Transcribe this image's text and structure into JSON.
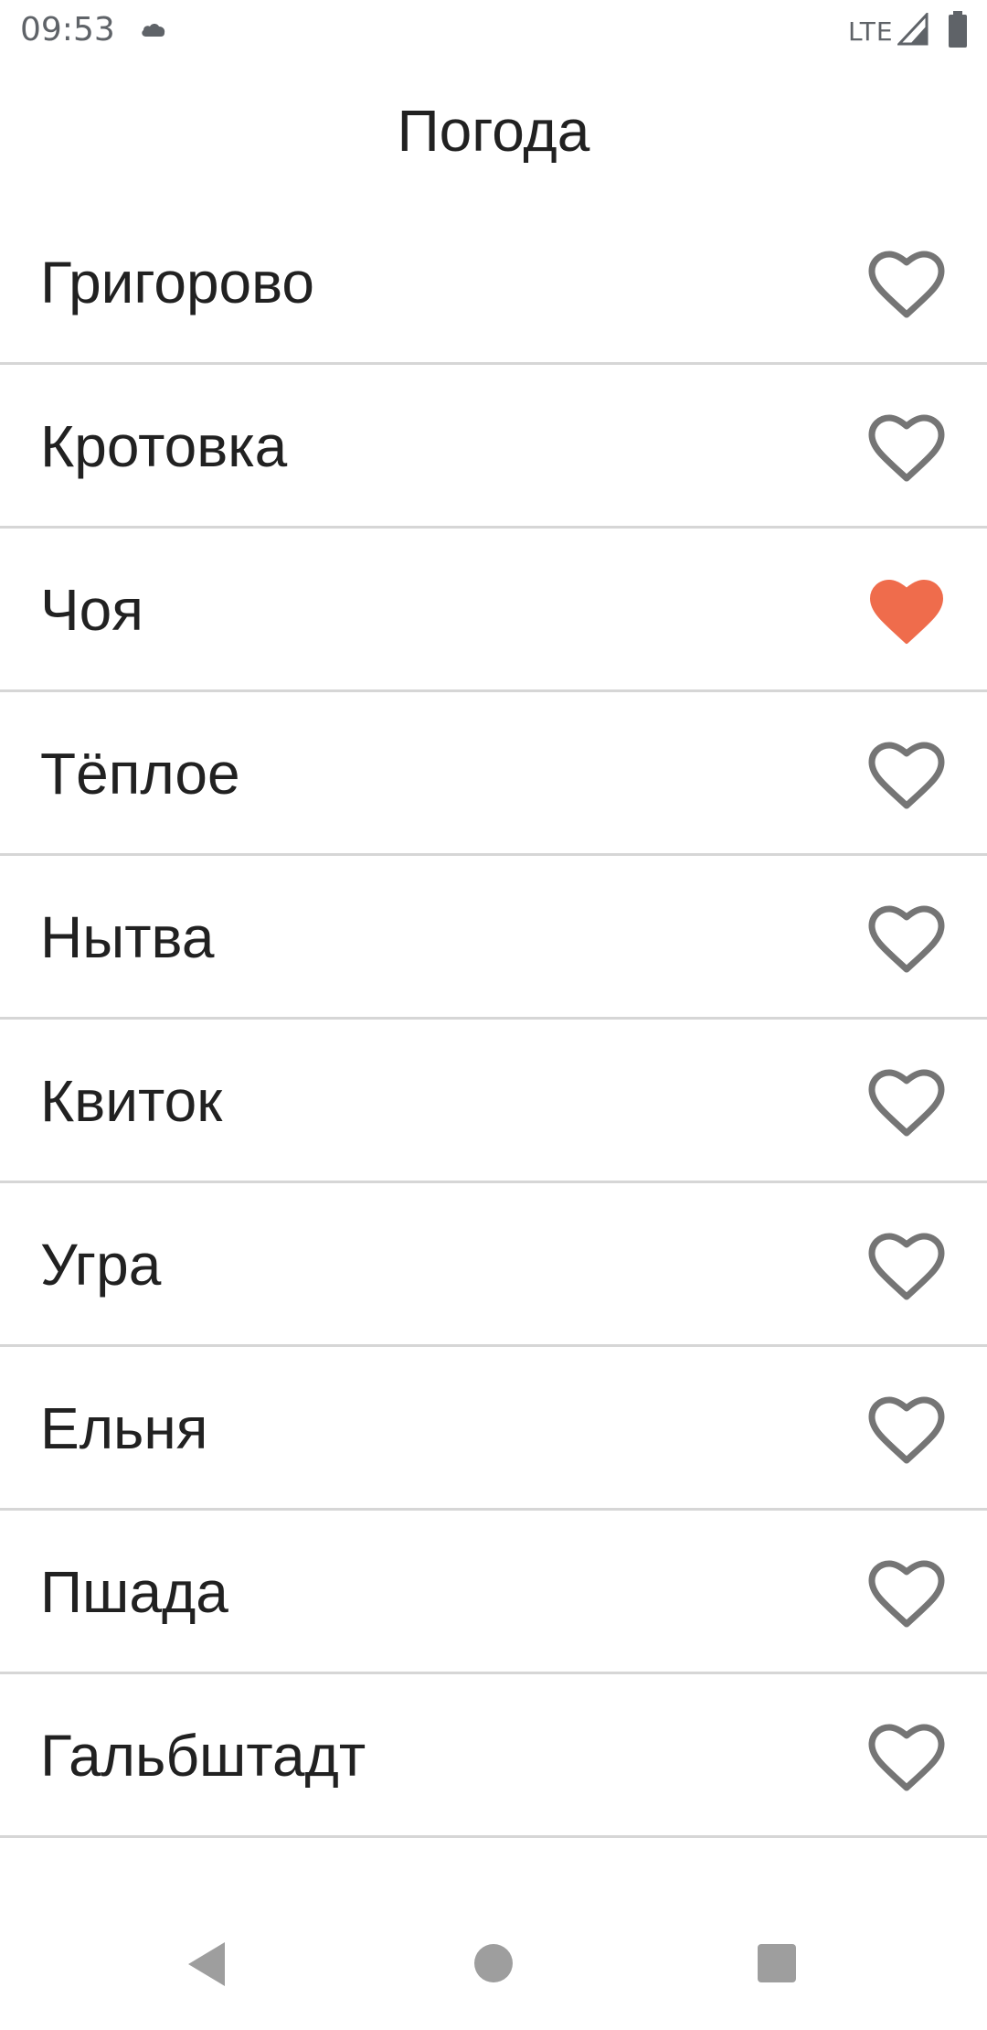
{
  "status_bar": {
    "time": "09:53",
    "network": "LTE",
    "icons": [
      "cloud-icon",
      "signal-icon",
      "battery-icon"
    ]
  },
  "app": {
    "title": "Погода"
  },
  "colors": {
    "favorite_active": "#EF6C4C",
    "favorite_inactive": "#757575",
    "divider": "#D6D6D6",
    "nav_icon": "#9E9E9E"
  },
  "cities": [
    {
      "name": "Григорово",
      "favorite": false
    },
    {
      "name": "Кротовка",
      "favorite": false
    },
    {
      "name": "Чоя",
      "favorite": true
    },
    {
      "name": "Тёплое",
      "favorite": false
    },
    {
      "name": "Нытва",
      "favorite": false
    },
    {
      "name": "Квиток",
      "favorite": false
    },
    {
      "name": "Угра",
      "favorite": false
    },
    {
      "name": "Ельня",
      "favorite": false
    },
    {
      "name": "Пшада",
      "favorite": false
    },
    {
      "name": "Гальбштадт",
      "favorite": false
    }
  ],
  "nav_bar": {
    "icons": [
      "back-icon",
      "home-icon",
      "recents-icon"
    ]
  }
}
